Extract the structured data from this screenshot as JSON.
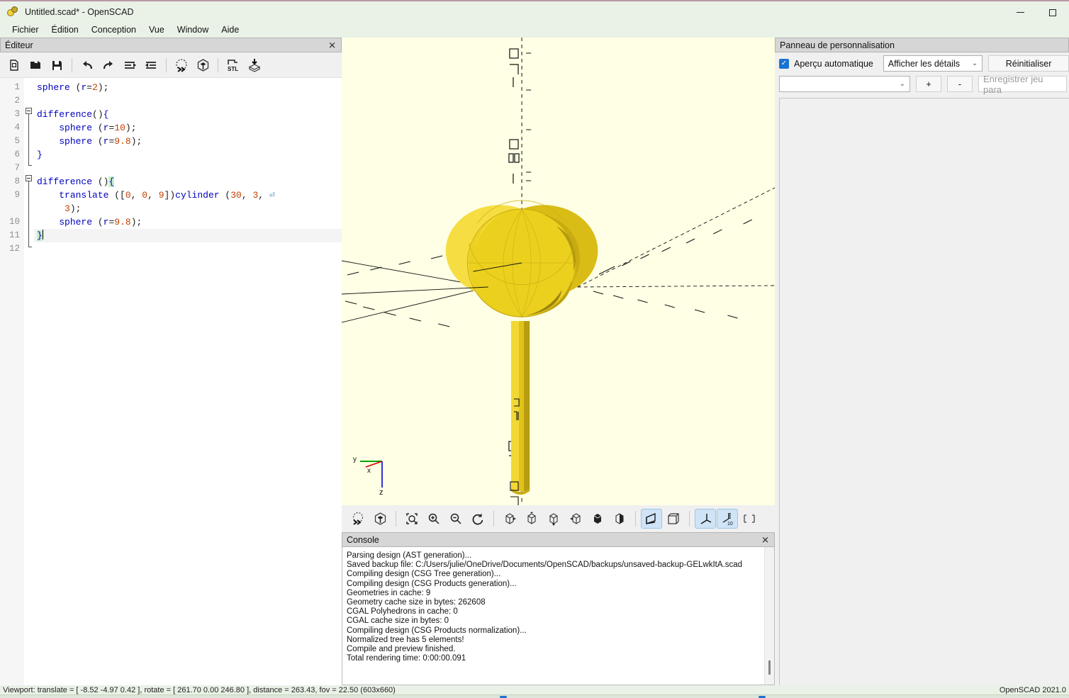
{
  "window": {
    "title": "Untitled.scad* - OpenSCAD",
    "icon": "openscad-logo-icon",
    "minimize_label": "−",
    "maximize_label": "□"
  },
  "menubar": {
    "items": [
      "Fichier",
      "Édition",
      "Conception",
      "Vue",
      "Window",
      "Aide"
    ]
  },
  "editor": {
    "dock_title": "Éditeur",
    "close_label": "✕",
    "toolbar": [
      {
        "name": "new-file-icon",
        "tip": "Nouveau"
      },
      {
        "name": "open-file-icon",
        "tip": "Ouvrir"
      },
      {
        "name": "save-file-icon",
        "tip": "Enregistrer"
      },
      {
        "name": "undo-icon",
        "tip": "Annuler"
      },
      {
        "name": "redo-icon",
        "tip": "Rétablir"
      },
      {
        "name": "unindent-icon",
        "tip": "Désindenter"
      },
      {
        "name": "indent-icon",
        "tip": "Indenter"
      },
      {
        "name": "preview-icon",
        "tip": "Aperçu"
      },
      {
        "name": "render-icon",
        "tip": "Rendu"
      },
      {
        "name": "export-stl-icon",
        "tip": "Exporter STL"
      },
      {
        "name": "export-generic-icon",
        "tip": "Exporter"
      }
    ],
    "line_numbers": [
      "1",
      "2",
      "3",
      "4",
      "5",
      "6",
      "7",
      "8",
      "9",
      "",
      "10",
      "11",
      "12"
    ],
    "lines": [
      {
        "n": "1",
        "text": "sphere (r=2);"
      },
      {
        "n": "2",
        "text": ""
      },
      {
        "n": "3",
        "text": "difference(){"
      },
      {
        "n": "4",
        "text": "    sphere (r=10);"
      },
      {
        "n": "5",
        "text": "    sphere (r=9.8);"
      },
      {
        "n": "6",
        "text": "}"
      },
      {
        "n": "7",
        "text": ""
      },
      {
        "n": "8",
        "text": "difference (){"
      },
      {
        "n": "9",
        "text": "    translate ([0, 0, 9])cylinder (30, 3,"
      },
      {
        "n": "",
        "text": "     3);"
      },
      {
        "n": "10",
        "text": "    sphere (r=9.8);"
      },
      {
        "n": "11",
        "text": "}"
      },
      {
        "n": "12",
        "text": ""
      }
    ]
  },
  "viewport": {
    "background_color": "#ffffe5",
    "model_color": "#f2d31b",
    "axis_labels": {
      "x": "x",
      "y": "y",
      "z": "z"
    },
    "axis_colors": {
      "x": "#d00000",
      "y": "#00a000",
      "z": "#0000d0"
    },
    "toolbar": [
      {
        "name": "preview-icon",
        "active": false
      },
      {
        "name": "render-icon",
        "active": false
      },
      {
        "name": "zoom-all-icon",
        "active": false
      },
      {
        "name": "zoom-in-icon",
        "active": false
      },
      {
        "name": "zoom-out-icon",
        "active": false
      },
      {
        "name": "reset-view-icon",
        "active": false
      },
      {
        "name": "view-right-icon",
        "active": false
      },
      {
        "name": "view-top-icon",
        "active": false
      },
      {
        "name": "view-bottom-icon",
        "active": false
      },
      {
        "name": "view-left-icon",
        "active": false
      },
      {
        "name": "view-front-icon",
        "active": false
      },
      {
        "name": "view-back-icon",
        "active": false
      },
      {
        "name": "perspective-icon",
        "active": true
      },
      {
        "name": "orthogonal-icon",
        "active": false
      },
      {
        "name": "show-axes-icon",
        "active": true
      },
      {
        "name": "show-scale-markers-icon",
        "active": true
      },
      {
        "name": "show-edges-icon",
        "active": false
      }
    ]
  },
  "console": {
    "dock_title": "Console",
    "close_label": "✕",
    "lines": [
      "Parsing design (AST generation)...",
      "Saved backup file: C:/Users/julie/OneDrive/Documents/OpenSCAD/backups/unsaved-backup-GELwkItA.scad",
      "Compiling design (CSG Tree generation)...",
      "Compiling design (CSG Products generation)...",
      "Geometries in cache: 9",
      "Geometry cache size in bytes: 262608",
      "CGAL Polyhedrons in cache: 0",
      "CGAL cache size in bytes: 0",
      "Compiling design (CSG Products normalization)...",
      "Normalized tree has 5 elements!",
      "Compile and preview finished.",
      "Total rendering time: 0:00:00.091"
    ]
  },
  "customizer": {
    "dock_title": "Panneau de personnalisation",
    "auto_preview_label": "Aperçu automatique",
    "auto_preview_checked": true,
    "detail_select_value": "Afficher les détails",
    "reset_label": "Réinitialiser",
    "preset_select_value": "",
    "add_label": "+",
    "remove_label": "-",
    "save_preset_placeholder": "Enregistrer jeu para"
  },
  "statusbar": {
    "viewport_info": "Viewport: translate = [ -8.52 -4.97 0.42 ], rotate = [ 261.70 0.00 246.80 ], distance = 263.43, fov = 22.50 (603x660)",
    "version": "OpenSCAD 2021.0"
  }
}
